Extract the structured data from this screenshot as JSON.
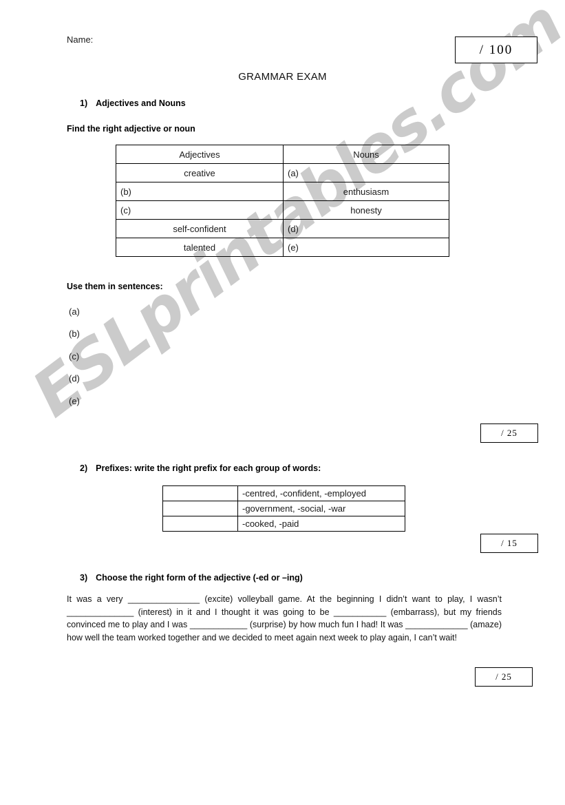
{
  "header": {
    "name_label": "Name:",
    "title": "GRAMMAR EXAM",
    "total_score": "/  100"
  },
  "section1": {
    "number": "1)",
    "heading": "Adjectives and Nouns",
    "instruction": "Find the right adjective or noun",
    "table": {
      "columns": [
        "Adjectives",
        "Nouns"
      ],
      "rows": [
        {
          "adjective": "creative",
          "noun": "(a)",
          "adjective_blank": false,
          "noun_blank": true
        },
        {
          "adjective": "(b)",
          "noun": "enthusiasm",
          "adjective_blank": true,
          "noun_blank": false
        },
        {
          "adjective": "(c)",
          "noun": "honesty",
          "adjective_blank": true,
          "noun_blank": false
        },
        {
          "adjective": "self-confident",
          "noun": "(d)",
          "adjective_blank": false,
          "noun_blank": true
        },
        {
          "adjective": "talented",
          "noun": "(e)",
          "adjective_blank": false,
          "noun_blank": true
        }
      ]
    },
    "sentences_instruction": "Use them in sentences:",
    "sentence_labels": [
      "(a)",
      "(b)",
      "(c)",
      "(d)",
      "(e)"
    ],
    "score": "/ 25"
  },
  "section2": {
    "number": "2)",
    "heading": "Prefixes: write the right prefix for each group of words:",
    "rows": [
      {
        "prefix": "",
        "words": "-centred, -confident, -employed"
      },
      {
        "prefix": "",
        "words": "-government, -social, -war"
      },
      {
        "prefix": "",
        "words": "-cooked, -paid"
      }
    ],
    "score": "/ 15"
  },
  "section3": {
    "number": "3)",
    "heading": "Choose the right form of the adjective (-ed or –ing)",
    "paragraph_parts": [
      "It was a very ",
      "_______________",
      " (excite) volleyball game. At the beginning I didn’t want to play, I wasn’t ",
      "______________",
      " (interest) in it and I thought it was going to be ",
      "___________",
      " (embarrass), but my friends convinced me to play and I was ",
      "____________",
      " (surprise) by how much fun I had! It was ",
      "_____________",
      " (amaze) how well the team worked together and we decided to meet again next week to play again, I can’t wait!"
    ],
    "score": "/ 25"
  },
  "watermark": {
    "text": "ESLprintables.com",
    "color": "#c9c9c9"
  }
}
